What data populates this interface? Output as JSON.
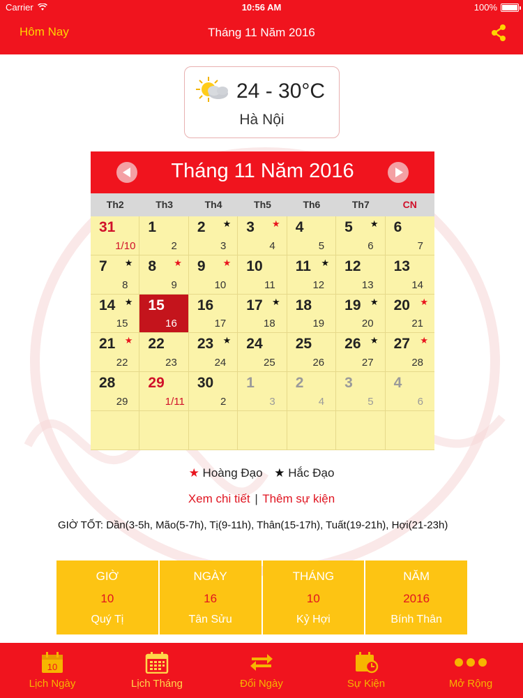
{
  "status_bar": {
    "carrier": "Carrier",
    "time": "10:56 AM",
    "battery": "100%"
  },
  "nav": {
    "today_label": "Hôm Nay",
    "title": "Tháng 11 Năm 2016"
  },
  "weather": {
    "temperature": "24 - 30°C",
    "city": "Hà Nội",
    "icon": "partly-cloudy-icon"
  },
  "calendar": {
    "title": "Tháng 11 Năm 2016",
    "weekdays": [
      "Th2",
      "Th3",
      "Th4",
      "Th5",
      "Th6",
      "Th7",
      "CN"
    ],
    "cells": [
      {
        "d": "31",
        "l": "1/10",
        "star": "",
        "type": "red"
      },
      {
        "d": "1",
        "l": "2",
        "star": "",
        "type": ""
      },
      {
        "d": "2",
        "l": "3",
        "star": "bad",
        "type": ""
      },
      {
        "d": "3",
        "l": "4",
        "star": "good",
        "type": ""
      },
      {
        "d": "4",
        "l": "5",
        "star": "",
        "type": ""
      },
      {
        "d": "5",
        "l": "6",
        "star": "bad",
        "type": ""
      },
      {
        "d": "6",
        "l": "7",
        "star": "",
        "type": ""
      },
      {
        "d": "7",
        "l": "8",
        "star": "bad",
        "type": ""
      },
      {
        "d": "8",
        "l": "9",
        "star": "good",
        "type": ""
      },
      {
        "d": "9",
        "l": "10",
        "star": "good",
        "type": ""
      },
      {
        "d": "10",
        "l": "11",
        "star": "",
        "type": ""
      },
      {
        "d": "11",
        "l": "12",
        "star": "bad",
        "type": ""
      },
      {
        "d": "12",
        "l": "13",
        "star": "",
        "type": ""
      },
      {
        "d": "13",
        "l": "14",
        "star": "",
        "type": ""
      },
      {
        "d": "14",
        "l": "15",
        "star": "bad",
        "type": ""
      },
      {
        "d": "15",
        "l": "16",
        "star": "",
        "type": "selected"
      },
      {
        "d": "16",
        "l": "17",
        "star": "",
        "type": ""
      },
      {
        "d": "17",
        "l": "18",
        "star": "bad",
        "type": ""
      },
      {
        "d": "18",
        "l": "19",
        "star": "",
        "type": ""
      },
      {
        "d": "19",
        "l": "20",
        "star": "bad",
        "type": ""
      },
      {
        "d": "20",
        "l": "21",
        "star": "good",
        "type": ""
      },
      {
        "d": "21",
        "l": "22",
        "star": "good",
        "type": ""
      },
      {
        "d": "22",
        "l": "23",
        "star": "",
        "type": ""
      },
      {
        "d": "23",
        "l": "24",
        "star": "bad",
        "type": ""
      },
      {
        "d": "24",
        "l": "25",
        "star": "",
        "type": ""
      },
      {
        "d": "25",
        "l": "26",
        "star": "",
        "type": ""
      },
      {
        "d": "26",
        "l": "27",
        "star": "bad",
        "type": ""
      },
      {
        "d": "27",
        "l": "28",
        "star": "good",
        "type": ""
      },
      {
        "d": "28",
        "l": "29",
        "star": "",
        "type": ""
      },
      {
        "d": "29",
        "l": "1/11",
        "star": "",
        "type": "red"
      },
      {
        "d": "30",
        "l": "2",
        "star": "",
        "type": ""
      },
      {
        "d": "1",
        "l": "3",
        "star": "",
        "type": "other"
      },
      {
        "d": "2",
        "l": "4",
        "star": "",
        "type": "other"
      },
      {
        "d": "3",
        "l": "5",
        "star": "",
        "type": "other"
      },
      {
        "d": "4",
        "l": "6",
        "star": "",
        "type": "other"
      },
      {
        "d": "",
        "l": "",
        "star": "",
        "type": ""
      },
      {
        "d": "",
        "l": "",
        "star": "",
        "type": ""
      },
      {
        "d": "",
        "l": "",
        "star": "",
        "type": ""
      },
      {
        "d": "",
        "l": "",
        "star": "",
        "type": ""
      },
      {
        "d": "",
        "l": "",
        "star": "",
        "type": ""
      },
      {
        "d": "",
        "l": "",
        "star": "",
        "type": ""
      },
      {
        "d": "",
        "l": "",
        "star": "",
        "type": ""
      }
    ]
  },
  "legend": {
    "good": "Hoàng Đạo",
    "bad": "Hắc Đạo"
  },
  "links": {
    "detail": "Xem chi tiết",
    "separator": "|",
    "add_event": "Thêm sự kiện"
  },
  "good_hours": "GIỜ TỐT: Dần(3-5h, Mão(5-7h), Tị(9-11h), Thân(15-17h), Tuất(19-21h), Hợi(21-23h)",
  "info": [
    {
      "label": "GIỜ",
      "value": "10",
      "can_chi": "Quý Tị"
    },
    {
      "label": "NGÀY",
      "value": "16",
      "can_chi": "Tân Sửu"
    },
    {
      "label": "THÁNG",
      "value": "10",
      "can_chi": "Kỷ Hợi"
    },
    {
      "label": "NĂM",
      "value": "2016",
      "can_chi": "Bính Thân"
    }
  ],
  "tabs": [
    {
      "label": "Lịch Ngày",
      "icon": "day-calendar-icon",
      "icon_text": "10"
    },
    {
      "label": "Lịch Tháng",
      "icon": "month-calendar-icon",
      "icon_text": ""
    },
    {
      "label": "Đổi Ngày",
      "icon": "convert-arrows-icon",
      "icon_text": ""
    },
    {
      "label": "Sự Kiện",
      "icon": "event-calendar-icon",
      "icon_text": ""
    },
    {
      "label": "Mở Rộng",
      "icon": "more-dots-icon",
      "icon_text": ""
    }
  ],
  "colors": {
    "brand_red": "#f0141e",
    "calendar_yellow": "#fbf3a9",
    "info_yellow": "#fdc413",
    "tab_gold": "#f7b500"
  }
}
